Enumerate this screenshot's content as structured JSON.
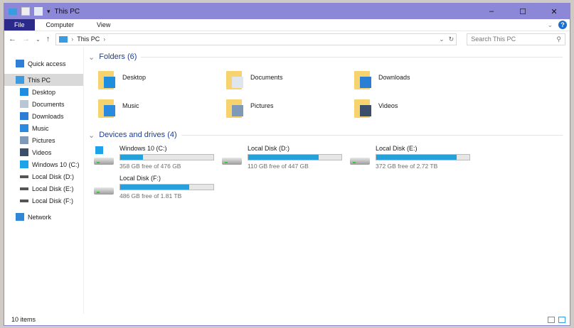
{
  "window": {
    "title": "This PC",
    "controls": [
      "–",
      "☐",
      "✕"
    ]
  },
  "ribbon": {
    "tabs": [
      "File",
      "Computer",
      "View"
    ]
  },
  "address": {
    "path": "This PC",
    "search_placeholder": "Search This PC"
  },
  "sidebar": {
    "items": [
      {
        "label": "Quick access",
        "icon": "star-icon",
        "color": "#2f7fd6"
      },
      {
        "label": "This PC",
        "icon": "computer-icon",
        "color": "#3a9be0",
        "selected": true
      },
      {
        "label": "Desktop",
        "icon": "desktop-icon",
        "color": "#1f8de0"
      },
      {
        "label": "Documents",
        "icon": "documents-icon",
        "color": "#b9c6d6"
      },
      {
        "label": "Downloads",
        "icon": "downloads-icon",
        "color": "#2a7fd4"
      },
      {
        "label": "Music",
        "icon": "music-icon",
        "color": "#2a8ae0"
      },
      {
        "label": "Pictures",
        "icon": "pictures-icon",
        "color": "#7e9ab8"
      },
      {
        "label": "Videos",
        "icon": "videos-icon",
        "color": "#3b4f6b"
      },
      {
        "label": "Windows 10 (C:)",
        "icon": "windows-drive-icon",
        "color": "#1fa3e8"
      },
      {
        "label": "Local Disk (D:)",
        "icon": "drive-icon",
        "color": "#555555"
      },
      {
        "label": "Local Disk (E:)",
        "icon": "drive-icon",
        "color": "#555555"
      },
      {
        "label": "Local Disk (F:)",
        "icon": "drive-icon",
        "color": "#555555"
      },
      {
        "label": "Network",
        "icon": "network-icon",
        "color": "#2f87d6"
      }
    ]
  },
  "folders": {
    "heading": "Folders (6)",
    "items": [
      {
        "label": "Desktop",
        "icon": "desktop-folder-icon",
        "overlay": "#1f8de0"
      },
      {
        "label": "Documents",
        "icon": "documents-folder-icon",
        "overlay": "#dfe6ee"
      },
      {
        "label": "Downloads",
        "icon": "downloads-folder-icon",
        "overlay": "#2a7fd4"
      },
      {
        "label": "Music",
        "icon": "music-folder-icon",
        "overlay": "#2a8ae0"
      },
      {
        "label": "Pictures",
        "icon": "pictures-folder-icon",
        "overlay": "#7e9ab8"
      },
      {
        "label": "Videos",
        "icon": "videos-folder-icon",
        "overlay": "#3b4f6b"
      }
    ]
  },
  "drives": {
    "heading": "Devices and drives (4)",
    "items": [
      {
        "label": "Windows 10 (C:)",
        "free": "358 GB free of 476 GB",
        "used_percent": 24.8,
        "windows": true
      },
      {
        "label": "Local Disk (D:)",
        "free": "110 GB free of 447 GB",
        "used_percent": 75.4
      },
      {
        "label": "Local Disk (E:)",
        "free": "372 GB free of 2.72 TB",
        "used_percent": 86.6
      },
      {
        "label": "Local Disk (F:)",
        "free": "486 GB free of 1.81 TB",
        "used_percent": 73.8
      }
    ]
  },
  "status": {
    "items": "10 items"
  },
  "colors": {
    "titlebar": "#8c87d6",
    "file_tab": "#2b2a8a",
    "usage_bar": "#26a0da",
    "heading": "#1e3d8f"
  }
}
